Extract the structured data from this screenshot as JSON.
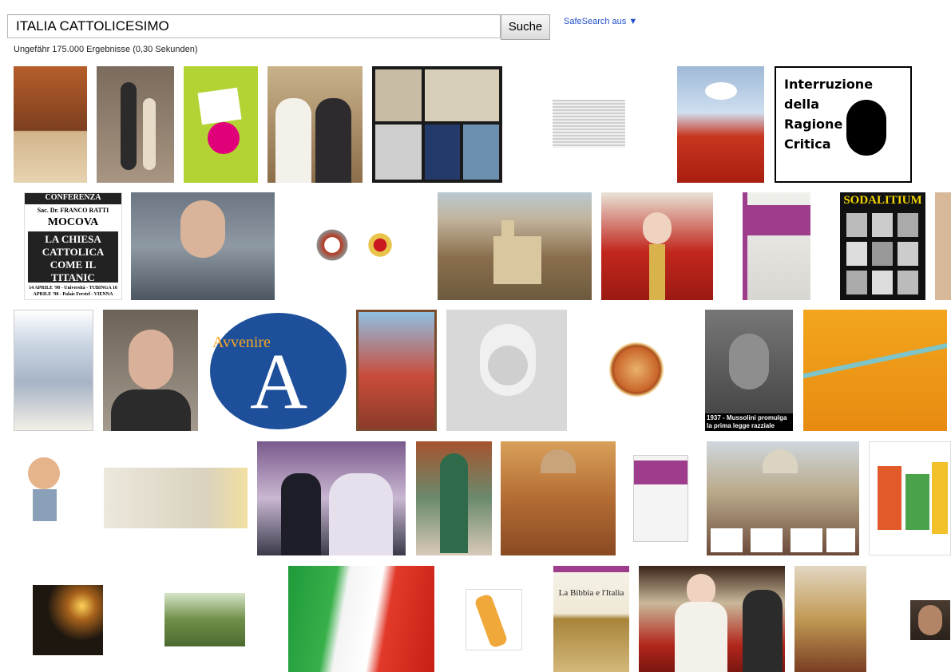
{
  "search": {
    "query": "ITALIA CATTOLICESIMO",
    "button_label": "Suche",
    "safesearch_label": "SafeSearch aus ▼"
  },
  "results": {
    "stats": "Ungefähr 175.000 Ergebnisse (0,30 Sekunden)"
  },
  "thumbnails_text": {
    "interruzione": [
      "Interruzione della",
      "Ragione",
      "Critica"
    ],
    "conferenza_title": "CONFERENZA",
    "conferenza_speaker": "Sac. Dr. FRANCO RATTI",
    "conferenza_org": "MOCOVA",
    "conferenza_headline": "LA CHIESA CATTOLICA COME IL TITANIC",
    "conferenza_dates": "14 APRILE '98 - Università - TUBINGA  16 APRILE '98 - Palais Ferstel - VIENNA",
    "sodalitium": "SODALITIUM",
    "avvenire": "Avvenire",
    "boy_caption": "1937 - Mussolini promulga la prima legge razziale",
    "bibbia": "La Bibbia e l'Italia"
  }
}
